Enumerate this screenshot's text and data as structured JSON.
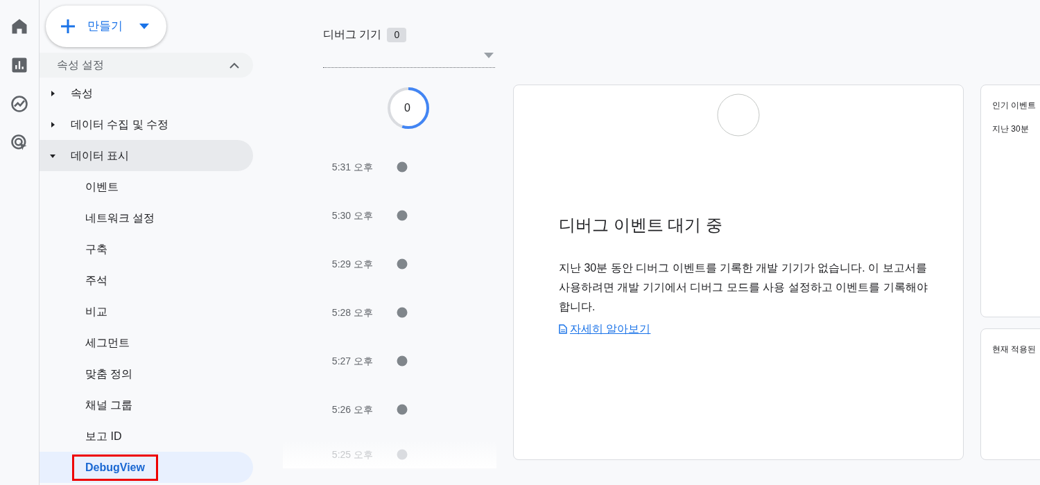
{
  "rail": [
    {
      "kind": "home",
      "selected": false
    },
    {
      "kind": "reports",
      "selected": false
    },
    {
      "kind": "explore",
      "selected": false
    },
    {
      "kind": "advertising",
      "selected": false
    }
  ],
  "create_button": {
    "label": "만들기"
  },
  "sidebar": {
    "section": {
      "label": "속성 설정",
      "expanded": true
    },
    "items": [
      {
        "label": "속성",
        "expanded": false,
        "selected": false
      },
      {
        "label": "데이터 수집 및 수정",
        "expanded": false,
        "selected": false
      },
      {
        "label": "데이터 표시",
        "expanded": true,
        "selected": false,
        "children": [
          {
            "label": "이벤트",
            "selected": false,
            "highlighted": false
          },
          {
            "label": "네트워크 설정",
            "selected": false,
            "highlighted": false
          },
          {
            "label": "구축",
            "selected": false,
            "highlighted": false
          },
          {
            "label": "주석",
            "selected": false,
            "highlighted": false
          },
          {
            "label": "비교",
            "selected": false,
            "highlighted": false
          },
          {
            "label": "세그먼트",
            "selected": false,
            "highlighted": false
          },
          {
            "label": "맞춤 정의",
            "selected": false,
            "highlighted": false
          },
          {
            "label": "채널 그룹",
            "selected": false,
            "highlighted": false
          },
          {
            "label": "보고 ID",
            "selected": false,
            "highlighted": false
          },
          {
            "label": "DebugView",
            "selected": true,
            "highlighted": true
          }
        ]
      }
    ]
  },
  "device_selector": {
    "label": "디버그 기기",
    "count": "0"
  },
  "timeline": {
    "counter": "0",
    "level": 0.55,
    "times": [
      {
        "label": "5:31 오후",
        "faded": false
      },
      {
        "label": "5:30 오후",
        "faded": false
      },
      {
        "label": "5:29 오후",
        "faded": false
      },
      {
        "label": "5:28 오후",
        "faded": false
      },
      {
        "label": "5:27 오후",
        "faded": false
      },
      {
        "label": "5:26 오후",
        "faded": false
      },
      {
        "label": "5:25 오후",
        "faded": true
      }
    ]
  },
  "main_card": {
    "title": "디버그 이벤트 대기 중",
    "message": "지난 30분 동안 디버그 이벤트를 기록한 개발 기기가 없습니다. 이 보고서를 사용하려면 개발 기기에서 디버그 모드를 사용 설정하고 이벤트를 기록해야 합니다.",
    "link": "자세히 알아보기"
  },
  "side_cards": [
    {
      "title": "인기 이벤트",
      "subtitle": "지난 30분"
    },
    {
      "title": "현재 적용된"
    }
  ]
}
